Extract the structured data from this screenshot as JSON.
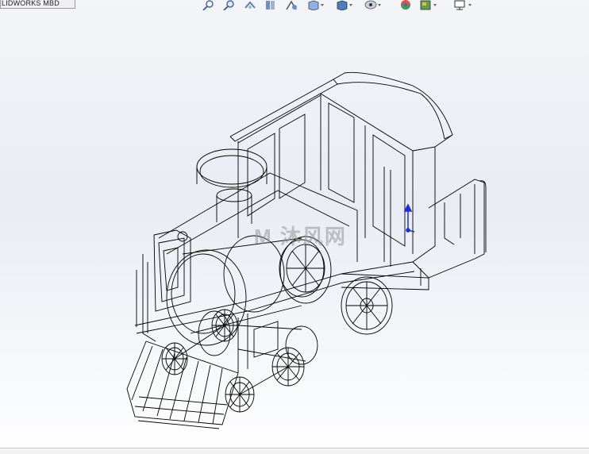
{
  "document_tab": {
    "label": "LIDWORKS MBD"
  },
  "toolbar": {
    "icons": [
      "zoom-to-fit-icon",
      "zoom-area-icon",
      "previous-view-icon",
      "section-view-icon",
      "dynamic-annotation-icon",
      "view-orientation-icon",
      "display-style-icon",
      "hide-show-items-icon",
      "edit-appearance-icon",
      "apply-scene-icon",
      "view-settings-icon"
    ]
  },
  "watermark": {
    "text": "M 沐风网"
  },
  "colors": {
    "wire": "#000000",
    "triad_axis": "#1a2fd6",
    "background_top": "#f4f5f8",
    "background_bottom": "#ffffff"
  }
}
